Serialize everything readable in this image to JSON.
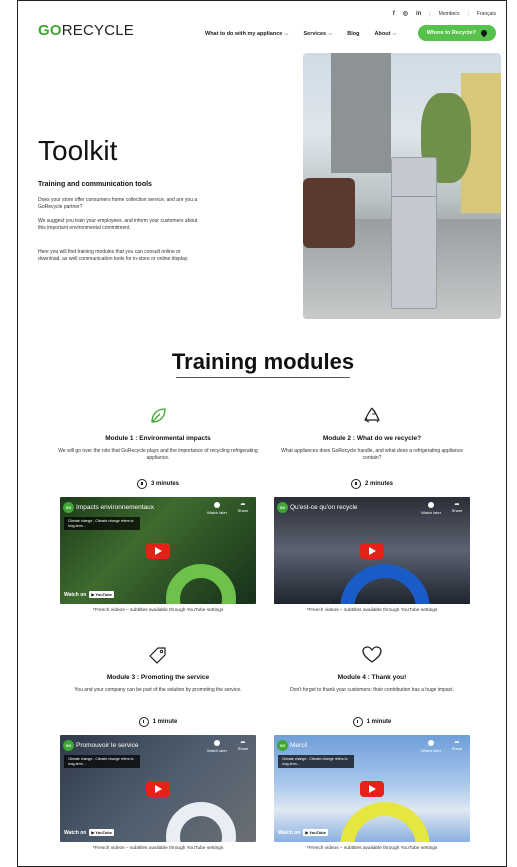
{
  "topbar": {
    "facebook": "f",
    "instagram": "◎",
    "linkedin": "in",
    "members": "Members",
    "language": "Français"
  },
  "logo": {
    "go": "GO",
    "recycle": "RECYCLE"
  },
  "nav": {
    "items": [
      "What to do with my appliance",
      "Services",
      "Blog",
      "About"
    ],
    "cta": "Where to Recycle?"
  },
  "hero": {
    "title": "Toolkit",
    "subtitle": "Training and communication tools",
    "p1": "Does your store offer consumers home collection service, and are you a GoRecycle partner?",
    "p2": "We suggest you train your employees, and inform your customers about this important environmental commitment.",
    "p3": "Here you will find training modules that you can consult online or download, as well communication tools for in-store or online display."
  },
  "section": {
    "title": "Training modules"
  },
  "modules": [
    {
      "title": "Module 1 : Environmental impacts",
      "desc": "We will go over the role that GoRecycle plays and the importance of recycling refrigerating appliance.",
      "duration": "3 minutes",
      "video_title": "Impacts environnementaux",
      "note": "*French videos – subtitles available through YouTube settings"
    },
    {
      "title": "Module 2 : What do we recycle?",
      "desc": "What appliances does GoRecycle handle, and what does a refrigerating appliance contain?",
      "duration": "2 minutes",
      "video_title": "Qu'est-ce qu'on recycle",
      "note": "*French videos – subtitles available through YouTube settings"
    },
    {
      "title": "Module 3 : Promoting the service",
      "desc": "You and your company can be part of the solution by promoting the service.",
      "duration": "1 minute",
      "video_title": "Promouvoir le service",
      "note": "*French videos – subtitles available through YouTube settings"
    },
    {
      "title": "Module 4 : Thank you!",
      "desc": "Don't forget to thank your customers: their contribution has a huge impact.",
      "duration": "1 minute",
      "video_title": "Merci!",
      "note": "*French videos – subtitles available through YouTube settings"
    }
  ],
  "video_ui": {
    "caption": "Climate change - Climate change refers to long-term...",
    "watch_later": "Watch later",
    "share": "Share",
    "watch_on": "Watch on",
    "youtube": "▶ YouTube",
    "channel": "GO"
  },
  "colors": {
    "brand_green": "#3fa535",
    "cta_green": "#56c14b",
    "play_red": "#e62117"
  },
  "icons": {
    "m1": "leaf-icon",
    "m2": "recycle-icon",
    "m3": "tag-icon",
    "m4": "heart-icon",
    "duration": "clock-icon"
  }
}
